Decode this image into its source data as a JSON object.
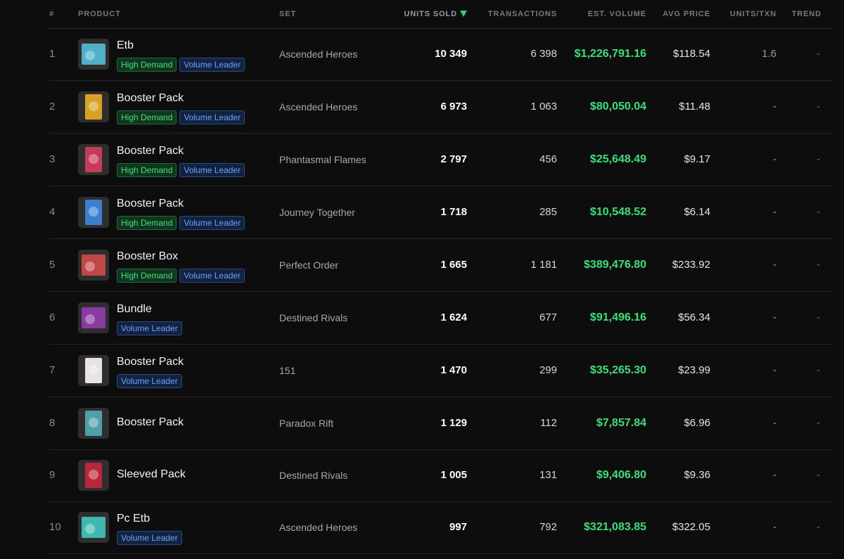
{
  "headers": {
    "rank": "#",
    "product": "PRODUCT",
    "set": "SET",
    "units_sold": "UNITS SOLD",
    "transactions": "TRANSACTIONS",
    "est_volume": "EST. VOLUME",
    "avg_price": "AVG PRICE",
    "units_per_txn": "UNITS/TXN",
    "trend": "TREND"
  },
  "sort": {
    "column": "units_sold",
    "direction": "desc",
    "icon": "sort-desc-icon",
    "color": "#2bd46b"
  },
  "badge_labels": {
    "demand": "High Demand",
    "leader": "Volume Leader"
  },
  "colors": {
    "volume": "#39e07a",
    "demand_badge": "#3ee07a",
    "leader_badge": "#6aa3ff"
  },
  "rows": [
    {
      "rank": "1",
      "product": "Etb",
      "badges": [
        "demand",
        "leader"
      ],
      "set": "Ascended Heroes",
      "units": "10 349",
      "transactions": "6 398",
      "volume": "$1,226,791.16",
      "avg": "$118.54",
      "upt": "1.6",
      "trend": "-",
      "thumb": {
        "icon": "etb-box-icon",
        "shape": "box",
        "color": "#4fb0c8"
      }
    },
    {
      "rank": "2",
      "product": "Booster Pack",
      "badges": [
        "demand",
        "leader"
      ],
      "set": "Ascended Heroes",
      "units": "6 973",
      "transactions": "1 063",
      "volume": "$80,050.04",
      "avg": "$11.48",
      "upt": "-",
      "trend": "-",
      "thumb": {
        "icon": "booster-pack-icon",
        "shape": "pack",
        "color": "#d8a325"
      }
    },
    {
      "rank": "3",
      "product": "Booster Pack",
      "badges": [
        "demand",
        "leader"
      ],
      "set": "Phantasmal Flames",
      "units": "2 797",
      "transactions": "456",
      "volume": "$25,648.49",
      "avg": "$9.17",
      "upt": "-",
      "trend": "-",
      "thumb": {
        "icon": "booster-pack-icon",
        "shape": "pack",
        "color": "#c83a5a"
      }
    },
    {
      "rank": "4",
      "product": "Booster Pack",
      "badges": [
        "demand",
        "leader"
      ],
      "set": "Journey Together",
      "units": "1 718",
      "transactions": "285",
      "volume": "$10,548.52",
      "avg": "$6.14",
      "upt": "-",
      "trend": "-",
      "thumb": {
        "icon": "booster-pack-icon",
        "shape": "pack",
        "color": "#3a7fd0"
      }
    },
    {
      "rank": "5",
      "product": "Booster Box",
      "badges": [
        "demand",
        "leader"
      ],
      "set": "Perfect Order",
      "units": "1 665",
      "transactions": "1 181",
      "volume": "$389,476.80",
      "avg": "$233.92",
      "upt": "-",
      "trend": "-",
      "thumb": {
        "icon": "booster-box-icon",
        "shape": "box",
        "color": "#c24848"
      }
    },
    {
      "rank": "6",
      "product": "Bundle",
      "badges": [
        "leader"
      ],
      "set": "Destined Rivals",
      "units": "1 624",
      "transactions": "677",
      "volume": "$91,496.16",
      "avg": "$56.34",
      "upt": "-",
      "trend": "-",
      "thumb": {
        "icon": "bundle-box-icon",
        "shape": "box",
        "color": "#8a3aa0"
      }
    },
    {
      "rank": "7",
      "product": "Booster Pack",
      "badges": [
        "leader"
      ],
      "set": "151",
      "units": "1 470",
      "transactions": "299",
      "volume": "$35,265.30",
      "avg": "$23.99",
      "upt": "-",
      "trend": "-",
      "thumb": {
        "icon": "booster-pack-icon",
        "shape": "pack",
        "color": "#e8e2e2"
      }
    },
    {
      "rank": "8",
      "product": "Booster Pack",
      "badges": [],
      "set": "Paradox Rift",
      "units": "1 129",
      "transactions": "112",
      "volume": "$7,857.84",
      "avg": "$6.96",
      "upt": "-",
      "trend": "-",
      "thumb": {
        "icon": "booster-pack-icon",
        "shape": "pack",
        "color": "#4fa0a8"
      }
    },
    {
      "rank": "9",
      "product": "Sleeved Pack",
      "badges": [],
      "set": "Destined Rivals",
      "units": "1 005",
      "transactions": "131",
      "volume": "$9,406.80",
      "avg": "$9.36",
      "upt": "-",
      "trend": "-",
      "thumb": {
        "icon": "sleeved-pack-icon",
        "shape": "pack",
        "color": "#b8283a"
      }
    },
    {
      "rank": "10",
      "product": "Pc Etb",
      "badges": [
        "leader"
      ],
      "set": "Ascended Heroes",
      "units": "997",
      "transactions": "792",
      "volume": "$321,083.85",
      "avg": "$322.05",
      "upt": "-",
      "trend": "-",
      "thumb": {
        "icon": "etb-box-icon",
        "shape": "box",
        "color": "#3fb8b0"
      }
    }
  ]
}
